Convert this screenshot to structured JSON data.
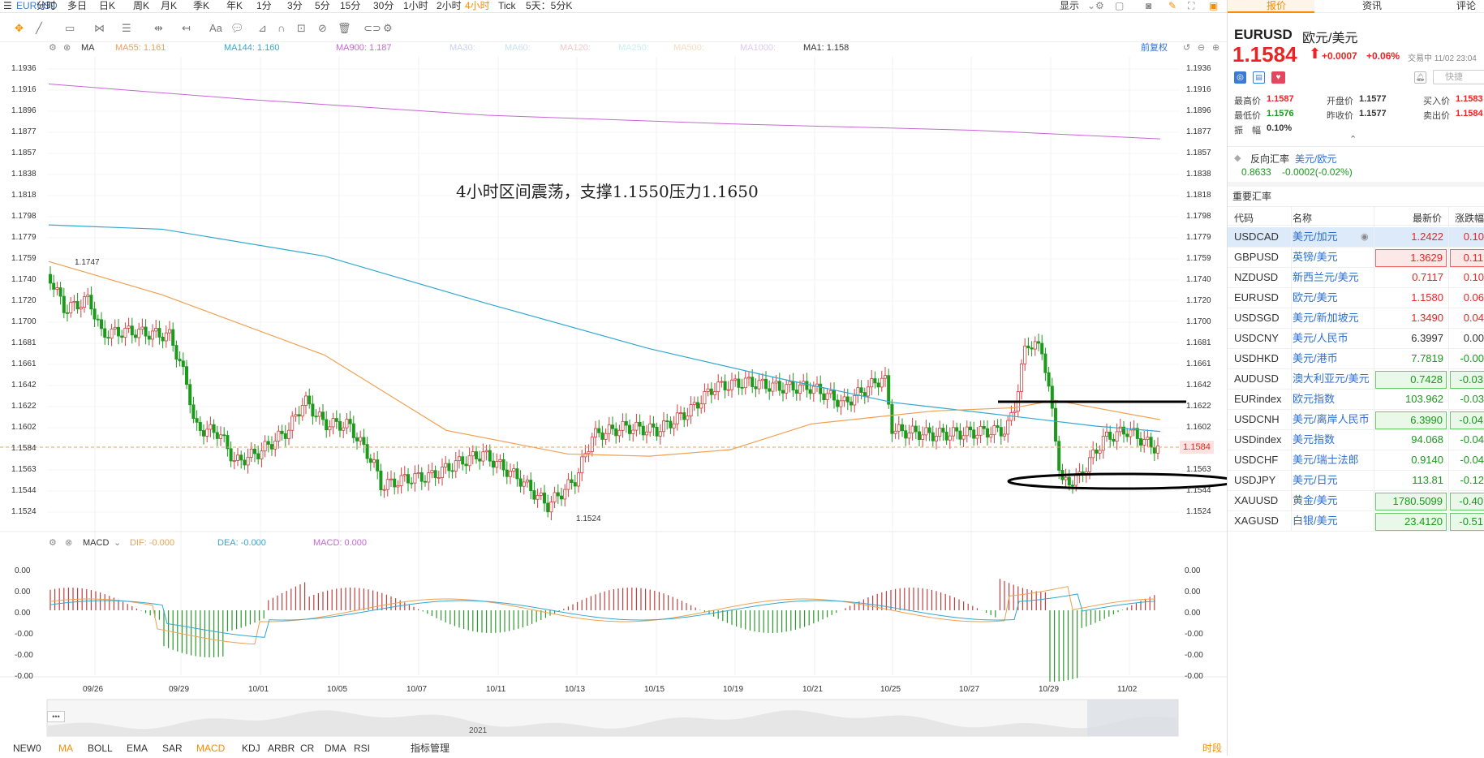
{
  "topbar": {
    "symbol": "EURUSD",
    "periods": [
      "分时",
      "多日",
      "日K",
      "周K",
      "月K",
      "季K",
      "年K",
      "1分",
      "3分",
      "5分",
      "15分",
      "30分",
      "1小时",
      "2小时",
      "4小时",
      "Tick",
      "5天：5分K"
    ],
    "active_period": "4小时",
    "display": "显示"
  },
  "toolbar": {
    "tools": [
      "cursor",
      "line",
      "rect",
      "pattern",
      "text-aa",
      "comment",
      "ruler",
      "magnet",
      "eye-off",
      "trash",
      "link",
      "settings"
    ]
  },
  "ma_legend": {
    "title": "MA",
    "items": [
      {
        "label": "MA55: 1.161",
        "color": "#f0a050"
      },
      {
        "label": "MA144: 1.160",
        "color": "#32a8cf"
      },
      {
        "label": "MA900: 1.187",
        "color": "#c765d6"
      },
      {
        "label": "MA30:",
        "color": "#c8d4f0"
      },
      {
        "label": "MA60:",
        "color": "#c8e0f4"
      },
      {
        "label": "MA120:",
        "color": "#f4c8c8"
      },
      {
        "label": "MA250:",
        "color": "#c8f0f0"
      },
      {
        "label": "MA500:",
        "color": "#f6dcc0"
      },
      {
        "label": "MA1000:",
        "color": "#e0c8f0"
      },
      {
        "label": "MA1: 1.158",
        "color": "#333"
      }
    ],
    "prev_adjust": "前复权"
  },
  "annotation": "4小时区间震荡，支撑1.1550压力1.1650",
  "price_axis": [
    "1.1936",
    "1.1916",
    "1.1896",
    "1.1877",
    "1.1857",
    "1.1838",
    "1.1818",
    "1.1798",
    "1.1779",
    "1.1759",
    "1.1740",
    "1.1720",
    "1.1700",
    "1.1681",
    "1.1661",
    "1.1642",
    "1.1622",
    "1.1602",
    "1.1584",
    "1.1563",
    "1.1544",
    "1.1524"
  ],
  "current_price_tag": "1.1584",
  "high_label": "1.1747",
  "low_label": "1.1524",
  "macd_legend": {
    "title": "MACD",
    "dif": "DIF: -0.000",
    "dea": "DEA: -0.000",
    "macd": "MACD: 0.000"
  },
  "macd_axis": [
    "0.00",
    "0.00",
    "0.00",
    "-0.00",
    "-0.00",
    "-0.00"
  ],
  "dates": [
    "09/26",
    "09/29",
    "10/01",
    "10/05",
    "10/07",
    "10/11",
    "10/13",
    "10/15",
    "10/19",
    "10/21",
    "10/25",
    "10/27",
    "10/29",
    "11/02"
  ],
  "navigator": {
    "year": "2021",
    "dots": "•••"
  },
  "indicator_tabs": [
    "NEW0",
    "MA",
    "BOLL",
    "EMA",
    "SAR",
    "MACD",
    "KDJ",
    "ARBR",
    "CR",
    "DMA",
    "RSI",
    "指标管理"
  ],
  "indicator_active": [
    "MA",
    "MACD"
  ],
  "more_link": "时段",
  "right": {
    "tabs": [
      "报价",
      "资讯",
      "评论"
    ],
    "active_tab": "报价",
    "code": "EURUSD",
    "name": "欧元/美元",
    "price": "1.1584",
    "arrow": "⬆",
    "change": "+0.0007",
    "pct": "+0.06%",
    "status": "交易中 11/02 23:04",
    "quick": "快捷",
    "stats": [
      {
        "label": "最高价",
        "value": "1.1587",
        "color": "red"
      },
      {
        "label": "开盘价",
        "value": "1.1577",
        "color": "dark"
      },
      {
        "label": "买入价",
        "value": "1.1583",
        "color": "red"
      },
      {
        "label": "最低价",
        "value": "1.1576",
        "color": "green"
      },
      {
        "label": "昨收价",
        "value": "1.1577",
        "color": "dark"
      },
      {
        "label": "卖出价",
        "value": "1.1584",
        "color": "red"
      },
      {
        "label": "振　幅",
        "value": "0.10%",
        "color": "dark"
      }
    ],
    "reverse": {
      "label": "反向汇率",
      "pair": "美元/欧元",
      "value": "0.8633",
      "change": "-0.0002(-0.02%)"
    },
    "section": "重要汇率",
    "headers": [
      "代码",
      "名称",
      "最新价",
      "涨跌幅"
    ],
    "rows": [
      {
        "code": "USDCAD",
        "name": "美元/加元",
        "price": "1.2422",
        "chg": "0.10",
        "color": "red",
        "box": ""
      },
      {
        "code": "GBPUSD",
        "name": "英镑/美元",
        "price": "1.3629",
        "chg": "0.11",
        "color": "red",
        "box": "red"
      },
      {
        "code": "NZDUSD",
        "name": "新西兰元/美元",
        "price": "0.7117",
        "chg": "0.10",
        "color": "red",
        "box": ""
      },
      {
        "code": "EURUSD",
        "name": "欧元/美元",
        "price": "1.1580",
        "chg": "0.06",
        "color": "red",
        "box": ""
      },
      {
        "code": "USDSGD",
        "name": "美元/新加坡元",
        "price": "1.3490",
        "chg": "0.04",
        "color": "red",
        "box": ""
      },
      {
        "code": "USDCNY",
        "name": "美元/人民币",
        "price": "6.3997",
        "chg": "0.00",
        "color": "dark",
        "box": ""
      },
      {
        "code": "USDHKD",
        "name": "美元/港币",
        "price": "7.7819",
        "chg": "-0.00",
        "color": "green",
        "box": ""
      },
      {
        "code": "AUDUSD",
        "name": "澳大利亚元/美元",
        "price": "0.7428",
        "chg": "-0.03",
        "color": "green",
        "box": "green"
      },
      {
        "code": "EURindex",
        "name": "欧元指数",
        "price": "103.962",
        "chg": "-0.03",
        "color": "green",
        "box": ""
      },
      {
        "code": "USDCNH",
        "name": "美元/离岸人民币",
        "price": "6.3990",
        "chg": "-0.04",
        "color": "green",
        "box": "green"
      },
      {
        "code": "USDindex",
        "name": "美元指数",
        "price": "94.068",
        "chg": "-0.04",
        "color": "green",
        "box": ""
      },
      {
        "code": "USDCHF",
        "name": "美元/瑞士法郎",
        "price": "0.9140",
        "chg": "-0.04",
        "color": "green",
        "box": ""
      },
      {
        "code": "USDJPY",
        "name": "美元/日元",
        "price": "113.81",
        "chg": "-0.12",
        "color": "green",
        "box": ""
      },
      {
        "code": "XAUUSD",
        "name": "黄金/美元",
        "price": "1780.5099",
        "chg": "-0.40",
        "color": "green",
        "box": "green"
      },
      {
        "code": "XAGUSD",
        "name": "白银/美元",
        "price": "23.4120",
        "chg": "-0.51",
        "color": "green",
        "box": "green"
      }
    ]
  }
}
